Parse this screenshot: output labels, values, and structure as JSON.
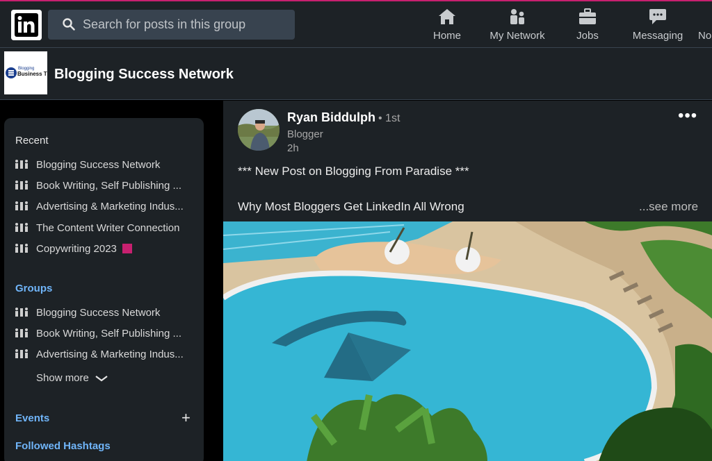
{
  "nav": {
    "search_placeholder": "Search for posts in this group",
    "items": [
      {
        "label": "Home",
        "icon": "home-icon"
      },
      {
        "label": "My Network",
        "icon": "network-icon"
      },
      {
        "label": "Jobs",
        "icon": "briefcase-icon"
      },
      {
        "label": "Messaging",
        "icon": "messaging-icon"
      },
      {
        "label": "No"
      }
    ],
    "accent_color": "#c7206f"
  },
  "group": {
    "name": "Blogging Success Network",
    "logo_text": [
      "Blogging",
      "Business Tips"
    ]
  },
  "sidebar": {
    "recent_title": "Recent",
    "recent": [
      "Blogging Success Network",
      "Book Writing, Self Publishing ...",
      "Advertising & Marketing Indus...",
      "The Content Writer Connection",
      "Copywriting 2023"
    ],
    "groups_title": "Groups",
    "groups": [
      "Blogging Success Network",
      "Book Writing, Self Publishing ...",
      "Advertising & Marketing Indus..."
    ],
    "show_more": "Show more",
    "events_title": "Events",
    "followed_hashtags_title": "Followed Hashtags"
  },
  "post": {
    "author": "Ryan Biddulph",
    "degree": "• 1st",
    "headline": "Blogger",
    "time": "2h",
    "line1": "*** New Post on Blogging From Paradise ***",
    "line2": "Why Most Bloggers Get LinkedIn All Wrong",
    "see_more": "...see more"
  }
}
